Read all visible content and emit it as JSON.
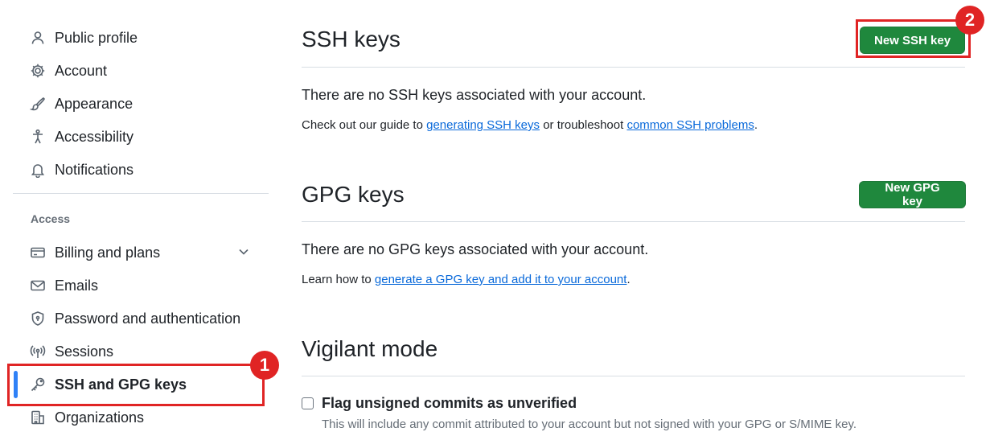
{
  "sidebar": {
    "items_top": [
      {
        "label": "Public profile",
        "icon": "person-icon"
      },
      {
        "label": "Account",
        "icon": "gear-icon"
      },
      {
        "label": "Appearance",
        "icon": "paintbrush-icon"
      },
      {
        "label": "Accessibility",
        "icon": "accessibility-icon"
      },
      {
        "label": "Notifications",
        "icon": "bell-icon"
      }
    ],
    "access_heading": "Access",
    "items_access": [
      {
        "label": "Billing and plans",
        "icon": "credit-card-icon"
      },
      {
        "label": "Emails",
        "icon": "mail-icon"
      },
      {
        "label": "Password and authentication",
        "icon": "shield-lock-icon"
      },
      {
        "label": "Sessions",
        "icon": "broadcast-icon"
      },
      {
        "label": "SSH and GPG keys",
        "icon": "key-icon",
        "active": true
      },
      {
        "label": "Organizations",
        "icon": "organization-icon"
      }
    ]
  },
  "annotations": {
    "badge1": "1",
    "badge2": "2",
    "color": "#e02424"
  },
  "ssh": {
    "title": "SSH keys",
    "button": "New SSH key",
    "empty_text": "There are no SSH keys associated with your account.",
    "guide_prefix": "Check out our guide to ",
    "guide_link": "generating SSH keys",
    "guide_middle": " or troubleshoot ",
    "guide_link2": "common SSH problems",
    "guide_suffix": "."
  },
  "gpg": {
    "title": "GPG keys",
    "button": "New GPG key",
    "empty_text": "There are no GPG keys associated with your account.",
    "learn_prefix": "Learn how to ",
    "learn_link": "generate a GPG key and add it to your account",
    "learn_suffix": "."
  },
  "vigilant": {
    "title": "Vigilant mode",
    "checkbox_label": "Flag unsigned commits as unverified",
    "checkbox_checked": false,
    "note": "This will include any commit attributed to your account but not signed with your GPG or S/MIME key."
  },
  "colors": {
    "primary_button": "#1f883d",
    "link": "#0969da",
    "active_indicator": "#2f81f7"
  }
}
